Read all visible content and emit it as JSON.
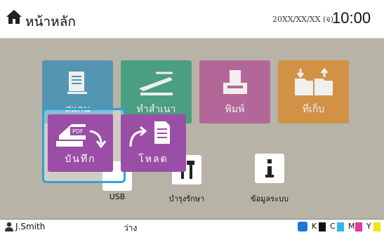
{
  "header": {
    "home_icon": "home-icon",
    "title": "หน้าหลัก",
    "date": "20XX/XX/XX (จ)",
    "time": "10:00"
  },
  "tiles": [
    {
      "label": "สแกน",
      "icon": "scan-doc-icon",
      "color": "#3b8fb5"
    },
    {
      "label": "ทำสำเนา",
      "icon": "copy-icon",
      "color": "#2f9a78"
    },
    {
      "label": "พิมพ์",
      "icon": "print-icon",
      "color": "#b35595"
    },
    {
      "label": "ที่เก็บ",
      "icon": "storage-icon",
      "color": "#d98b2f"
    }
  ],
  "small_tiles": [
    {
      "label": "USB",
      "icon": "usb-icon"
    },
    {
      "label": "บำรุงรักษา",
      "icon": "tools-icon"
    },
    {
      "label": "ข้อมูลระบบ",
      "icon": "info-icon"
    }
  ],
  "popup": {
    "save_label": "บันทึก",
    "load_label": "โหลด",
    "accent": "#2ba5d6"
  },
  "status": {
    "user": "J.Smith",
    "state": "ว่าง",
    "inks": [
      "K",
      "C",
      "M",
      "Y"
    ]
  }
}
